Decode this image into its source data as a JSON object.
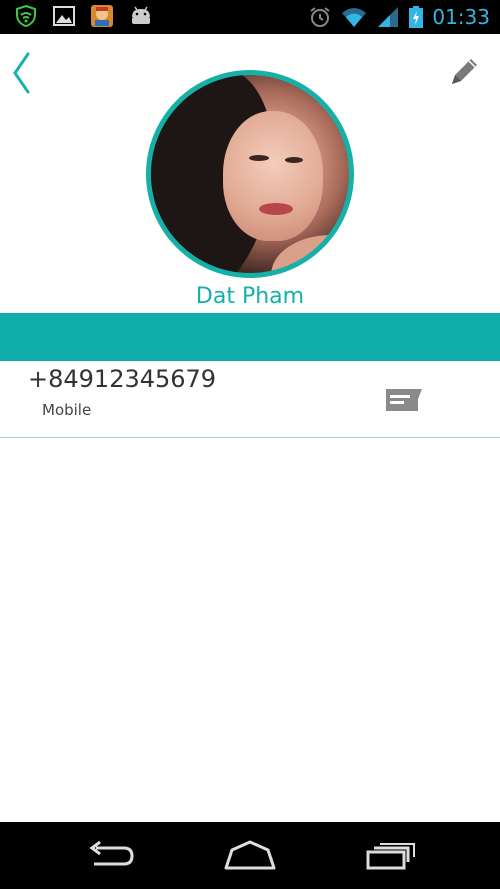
{
  "status_bar": {
    "left_icons": [
      "shield-wifi-icon",
      "image-icon",
      "game-app-icon",
      "android-icon"
    ],
    "right_icons": [
      "alarm-icon",
      "wifi-signal-icon",
      "cell-signal-icon",
      "battery-charging-icon"
    ],
    "time": "01:33"
  },
  "header": {
    "back_icon": "chevron-left-icon",
    "edit_icon": "pencil-icon"
  },
  "contact": {
    "name": "Dat Pham",
    "accent_color": "#15b0a8",
    "phones": [
      {
        "number": "+84912345679",
        "type": "Mobile",
        "action_icon": "message-icon"
      }
    ]
  },
  "nav_bar": {
    "buttons": [
      "back-icon",
      "home-icon",
      "recent-apps-icon"
    ]
  }
}
